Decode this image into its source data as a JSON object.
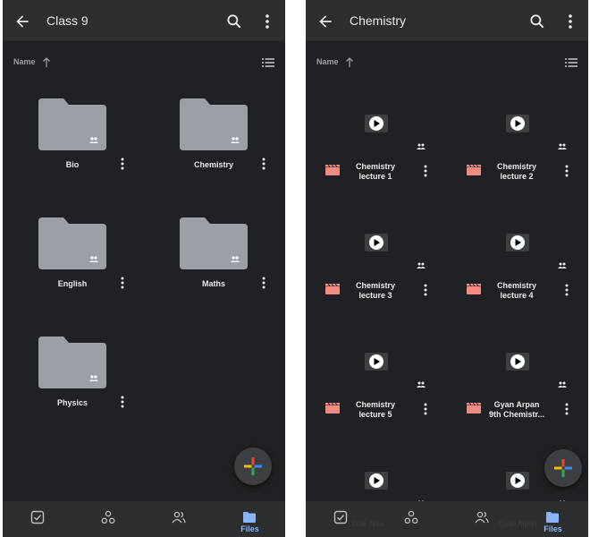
{
  "left_screen": {
    "title": "Class 9",
    "sort_label": "Name",
    "folders": [
      {
        "name": "Bio"
      },
      {
        "name": "Chemistry"
      },
      {
        "name": "English"
      },
      {
        "name": "Maths"
      },
      {
        "name": "Physics"
      }
    ],
    "nav": {
      "files_label": "Files"
    }
  },
  "right_screen": {
    "title": "Chemistry",
    "sort_label": "Name",
    "videos": [
      {
        "line1": "Chemistry",
        "line2": "lecture 1"
      },
      {
        "line1": "Chemistry",
        "line2": "lecture 2"
      },
      {
        "line1": "Chemistry",
        "line2": "lecture 3"
      },
      {
        "line1": "Chemistry",
        "line2": "lecture 4"
      },
      {
        "line1": "Chemistry",
        "line2": "lecture 5"
      },
      {
        "line1": "Gyan Arpan",
        "line2": "9th Chemistr..."
      }
    ],
    "nav": {
      "files_label": "Files"
    },
    "ghost_caption_left": "Free Apps",
    "ghost_caption_right": "Gyan Arpan"
  },
  "colors": {
    "background": "#202124",
    "app_bar": "#2d2e30",
    "folder": "#9aa0a6",
    "video_icon": "#f28b82",
    "accent": "#8ab4f8"
  },
  "icons": {
    "back": "arrow-back-icon",
    "search": "search-icon",
    "more": "more-vert-icon",
    "sort": "arrow-up-icon",
    "view": "list-view-icon",
    "folder": "shared-folder-icon",
    "video": "video-clapper-icon",
    "fab": "google-plus-icon",
    "nav": [
      "priority-icon",
      "workspaces-icon",
      "shared-icon",
      "files-icon"
    ]
  }
}
